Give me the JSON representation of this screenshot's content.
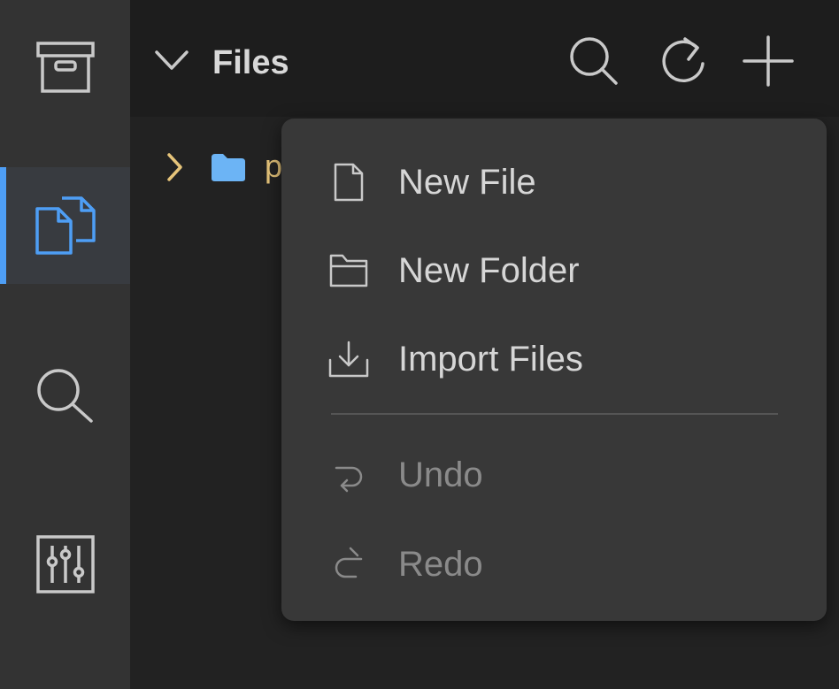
{
  "activity_bar": {
    "items": [
      {
        "icon": "archive-icon"
      },
      {
        "icon": "files-icon",
        "active": true
      },
      {
        "icon": "search-icon"
      },
      {
        "icon": "sliders-icon"
      }
    ],
    "accent_color": "#4e9ef5"
  },
  "sidebar": {
    "title": "Files",
    "actions": [
      {
        "icon": "search-icon"
      },
      {
        "icon": "refresh-icon"
      },
      {
        "icon": "plus-icon"
      }
    ]
  },
  "tree": {
    "items": [
      {
        "label": "p",
        "type": "folder",
        "expanded": false
      }
    ]
  },
  "context_menu": {
    "items": [
      {
        "label": "New File",
        "icon": "file-icon",
        "enabled": true
      },
      {
        "label": "New Folder",
        "icon": "folder-outline-icon",
        "enabled": true
      },
      {
        "label": "Import Files",
        "icon": "import-icon",
        "enabled": true
      },
      {
        "label": "Undo",
        "icon": "undo-icon",
        "enabled": false
      },
      {
        "label": "Redo",
        "icon": "redo-icon",
        "enabled": false
      }
    ]
  }
}
